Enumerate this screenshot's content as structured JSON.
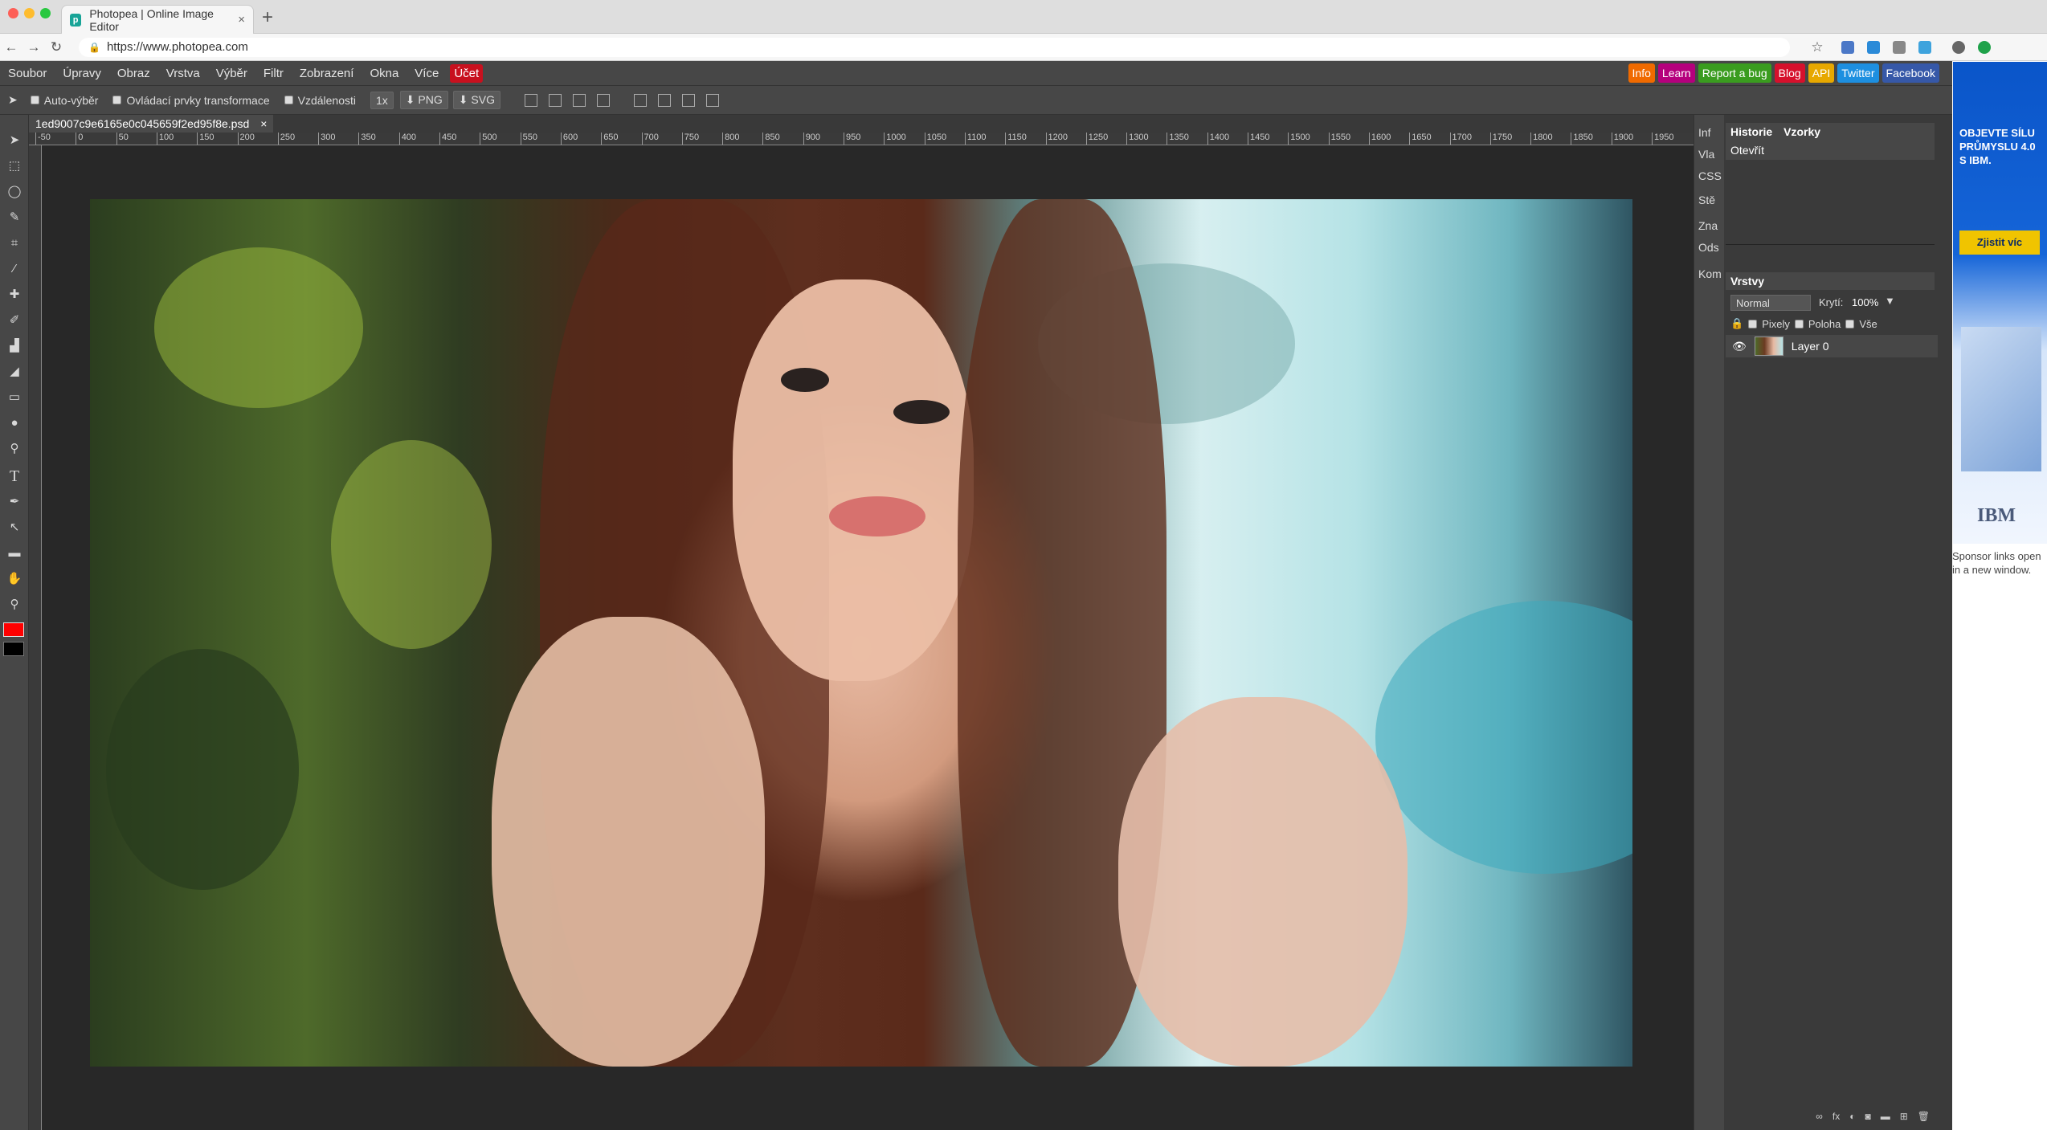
{
  "browser": {
    "tab_title": "Photopea | Online Image Editor",
    "tab_close": "×",
    "new_tab": "+",
    "url": "https://www.photopea.com",
    "nav_back": "←",
    "nav_forward": "→",
    "nav_reload": "↻",
    "bookmark_star": "☆"
  },
  "menu": {
    "items": [
      "Soubor",
      "Úpravy",
      "Obraz",
      "Vrstva",
      "Výběr",
      "Filtr",
      "Zobrazení",
      "Okna",
      "Více"
    ],
    "account": "Účet",
    "links": [
      {
        "label": "Info",
        "color": "#f06a00"
      },
      {
        "label": "Learn",
        "color": "#b5007d"
      },
      {
        "label": "Report a bug",
        "color": "#3a9c1f"
      },
      {
        "label": "Blog",
        "color": "#d6102c"
      },
      {
        "label": "API",
        "color": "#e7a800"
      },
      {
        "label": "Twitter",
        "color": "#1d8fe0"
      },
      {
        "label": "Facebook",
        "color": "#3658a8"
      }
    ]
  },
  "options": {
    "auto_select": "Auto-výběr",
    "transform_controls": "Ovládací prvky transformace",
    "distances": "Vzdálenosti",
    "zoom": "1x",
    "png": "PNG",
    "svg": "SVG"
  },
  "document": {
    "filename": "1ed9007c9e6165e0c045659f2ed95f8e.psd",
    "close": "×"
  },
  "ruler": {
    "ticks": [
      "-50",
      "0",
      "50",
      "100",
      "150",
      "200",
      "250",
      "300",
      "350",
      "400",
      "450",
      "500",
      "550",
      "600",
      "650",
      "700",
      "750",
      "800",
      "850",
      "900",
      "950",
      "1000",
      "1050",
      "1100",
      "1150",
      "1200",
      "1250",
      "1300",
      "1350",
      "1400",
      "1450",
      "1500",
      "1550",
      "1600",
      "1650",
      "1700",
      "1750",
      "1800",
      "1850",
      "1900",
      "1950"
    ]
  },
  "side_tabs": [
    "Inf",
    "Vla",
    "CSS",
    "Stě",
    "Zna",
    "Ods",
    "Kom"
  ],
  "history_panel": {
    "tabs": [
      "Historie",
      "Vzorky"
    ],
    "entry": "Otevřít"
  },
  "layers_panel": {
    "title": "Vrstvy",
    "blend_mode": "Normal",
    "opacity_label": "Krytí:",
    "opacity_value": "100%",
    "lock_options": [
      "Pixely",
      "Poloha",
      "Vše"
    ],
    "layer_name": "Layer 0"
  },
  "ad": {
    "headline": "OBJEVTE SÍLU PRŮMYSLU 4.0 S IBM.",
    "cta": "Zjistit víc",
    "brand": "IBM",
    "note": "Sponsor links open in a new window."
  },
  "colors": {
    "foreground": "#ff0000",
    "background": "#000000"
  }
}
